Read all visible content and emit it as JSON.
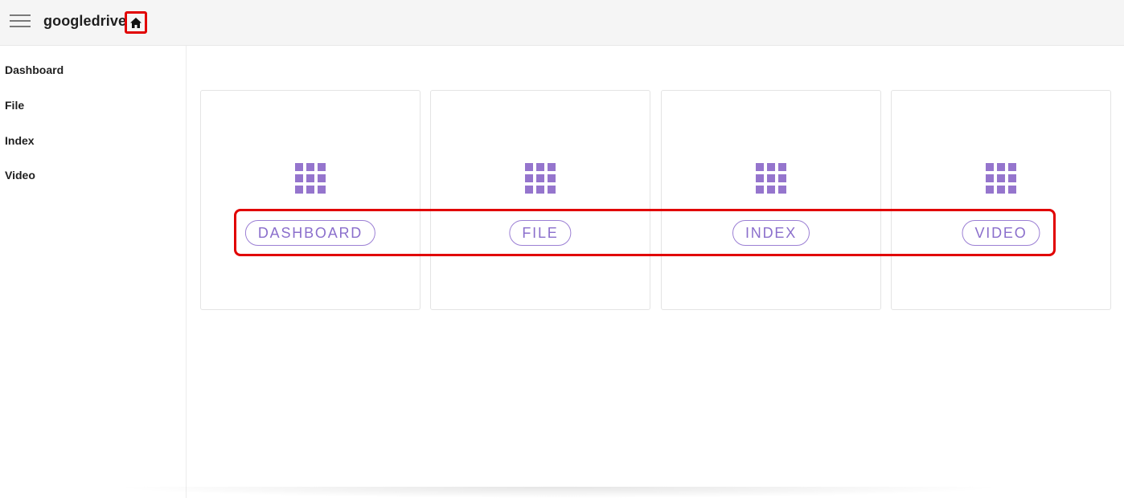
{
  "header": {
    "title": "googledrive",
    "menu_icon": "hamburger-menu-icon",
    "home_icon": "home-icon"
  },
  "sidebar": {
    "items": [
      {
        "label": "Dashboard"
      },
      {
        "label": "File"
      },
      {
        "label": "Index"
      },
      {
        "label": "Video"
      }
    ]
  },
  "cards": [
    {
      "icon": "apps-grid-icon",
      "button_label": "DASHBOARD"
    },
    {
      "icon": "apps-grid-icon",
      "button_label": "FILE"
    },
    {
      "icon": "apps-grid-icon",
      "button_label": "INDEX"
    },
    {
      "icon": "apps-grid-icon",
      "button_label": "VIDEO"
    }
  ],
  "colors": {
    "accent": "#9575cd",
    "highlight": "#e10000",
    "header_bg": "#f5f5f5"
  }
}
